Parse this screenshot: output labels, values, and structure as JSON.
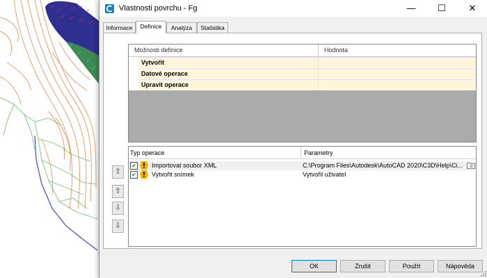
{
  "window": {
    "title": "Vlastnosti povrchu - Fg",
    "minimize": "—",
    "maximize": "☐",
    "close": "✕"
  },
  "tabs": [
    {
      "label": "Informace",
      "active": false
    },
    {
      "label": "Definice",
      "active": true
    },
    {
      "label": "Analýza",
      "active": false
    },
    {
      "label": "Statistika",
      "active": false
    }
  ],
  "definition_grid": {
    "columns": [
      "Možnosti definice",
      "Hodnota"
    ],
    "rows": [
      "Vytvořit",
      "Datové operace",
      "Upravit operace"
    ]
  },
  "operations_grid": {
    "columns": [
      "Typ operace",
      "Parametry"
    ],
    "rows": [
      {
        "name": "Importovat soubor XML",
        "params": "C:\\Program Files\\Autodesk\\AutoCAD 2020\\C3D\\Help\\Ci...",
        "checked": true
      },
      {
        "name": "Vytvořit snímek",
        "params": "Vytvořil uživatel",
        "checked": true
      }
    ]
  },
  "side_buttons": {
    "move_top": "⇧",
    "move_up": "⇧",
    "move_down": "⇩",
    "move_bottom": "⇩"
  },
  "buttons": {
    "ok": "OK",
    "cancel": "Zrušit",
    "apply": "Použít",
    "help": "Nápověda"
  },
  "colors": {
    "accent": "#0078d7",
    "row_highlight": "#fdf6d8",
    "warning": "#f0b400"
  }
}
